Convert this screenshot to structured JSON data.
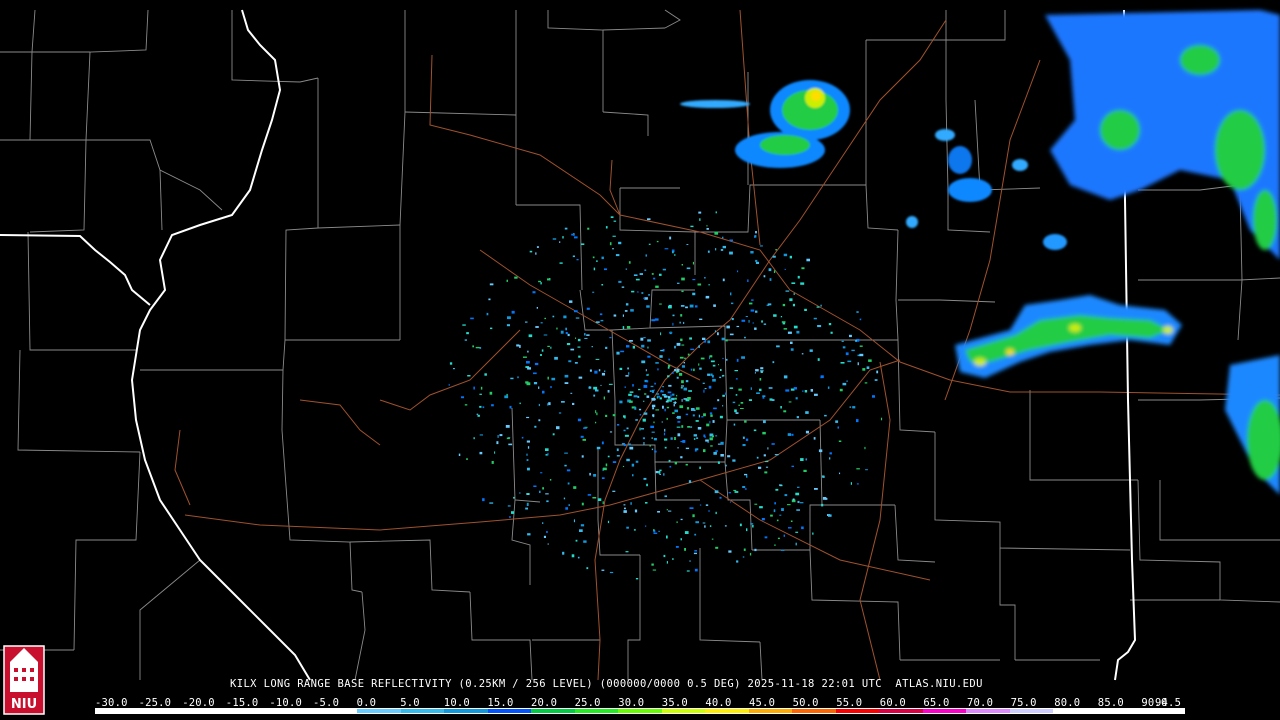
{
  "product": {
    "title": "KILX LONG RANGE BASE REFLECTIVITY (0.25KM / 256 LEVEL) (000000/0000 0.5 DEG) 2025-11-18 22:01 UTC  ATLAS.NIU.EDU"
  },
  "logo": {
    "text": "NIU",
    "icon": "university-tower-icon"
  },
  "color_scale": {
    "labels": [
      "-30.0",
      "-25.0",
      "-20.0",
      "-15.0",
      "-10.0",
      "-5.0",
      "0.0",
      "5.0",
      "10.0",
      "15.0",
      "20.0",
      "25.0",
      "30.0",
      "35.0",
      "40.0",
      "45.0",
      "50.0",
      "55.0",
      "60.0",
      "65.0",
      "70.0",
      "75.0",
      "80.0",
      "85.0",
      "90.0",
      "94.5"
    ],
    "colors": [
      "#ffffff",
      "#ffffff",
      "#ffffff",
      "#ffffff",
      "#ffffff",
      "#ffffff",
      "#66ccff",
      "#33bbee",
      "#1199dd",
      "#0055ff",
      "#00cc44",
      "#22ee22",
      "#66ff00",
      "#ccff00",
      "#ffee00",
      "#ffaa00",
      "#ff6600",
      "#ff0000",
      "#dd0044",
      "#ff00cc",
      "#dd88ff",
      "#ccccff",
      "#ffffff",
      "#ffffff",
      "#ffffff",
      "#ffffff"
    ]
  },
  "map": {
    "background": "#000000",
    "county_border_color": "#8a8a8a",
    "state_border_color": "#ffffff",
    "road_color": "#a0522d"
  }
}
